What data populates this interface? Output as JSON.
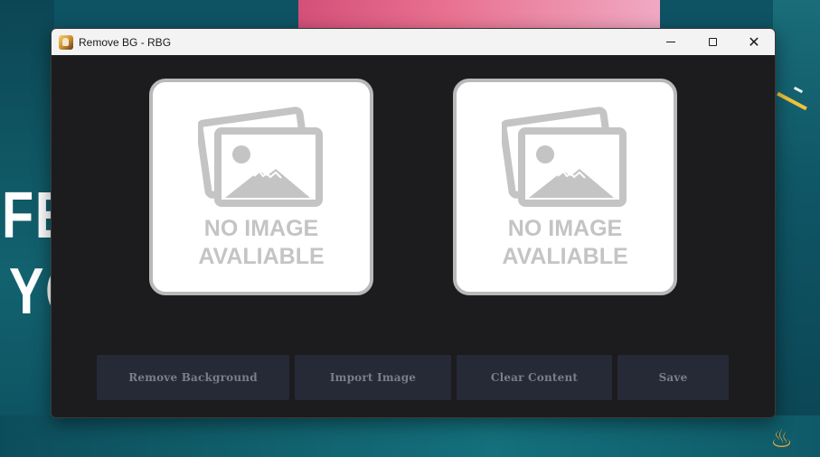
{
  "desktop": {
    "background_text_line1": "FE",
    "background_text_line2": "YO",
    "colors": {
      "background": "#0e5364",
      "accent_pink": "#e8708f",
      "accent_yellow": "#f0c33a"
    }
  },
  "window": {
    "title": "Remove BG - RBG",
    "app_icon": "app-logo-icon",
    "controls": {
      "minimize_icon": "minimize-icon",
      "maximize_icon": "maximize-icon",
      "close_icon": "close-icon"
    }
  },
  "panels": [
    {
      "name": "original-image",
      "placeholder_line1": "NO IMAGE",
      "placeholder_line2": "AVALIABLE",
      "icon": "image-placeholder-icon"
    },
    {
      "name": "result-image",
      "placeholder_line1": "NO IMAGE",
      "placeholder_line2": "AVALIABLE",
      "icon": "image-placeholder-icon"
    }
  ],
  "buttons": {
    "remove_background": "Remove Background",
    "import_image": "Import Image",
    "clear_content": "Clear Content",
    "save": "Save"
  },
  "colors": {
    "window_bg": "#1c1c1e",
    "titlebar_bg": "#f3f3f3",
    "button_bg": "#252a36",
    "button_text": "#7a7e88",
    "placeholder_gray": "#c4c4c4"
  }
}
